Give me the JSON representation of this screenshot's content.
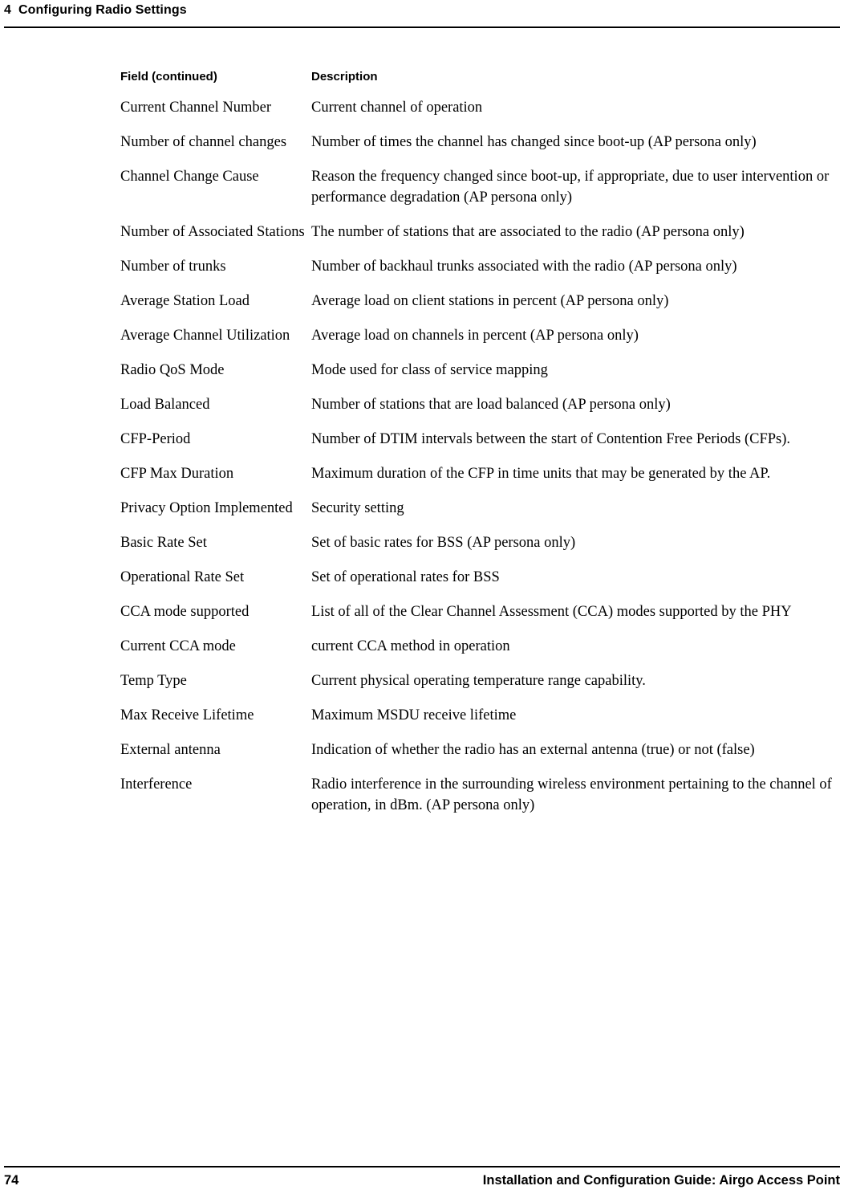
{
  "header": {
    "chapter_number": "4",
    "chapter_title": "Configuring Radio Settings"
  },
  "table": {
    "columns": {
      "field": "Field  (continued)",
      "description": "Description"
    },
    "rows": [
      {
        "field": "Current Channel Number",
        "description": "Current channel of operation"
      },
      {
        "field": "Number of channel changes",
        "description": "Number of times the channel has changed since boot-up (AP persona only)"
      },
      {
        "field": "Channel Change Cause",
        "description": "Reason the frequency changed since boot-up, if appropriate, due to user intervention or performance degradation (AP persona only)"
      },
      {
        "field": "Number of Associated Stations",
        "description": "The number of stations that are associated to the radio (AP persona only)"
      },
      {
        "field": "Number of trunks",
        "description": "Number of backhaul trunks associated with the radio (AP persona only)"
      },
      {
        "field": "Average Station Load",
        "description": "Average load on client stations in percent (AP persona only)"
      },
      {
        "field": "Average Channel Utilization",
        "description": "Average load on channels in percent (AP persona only)"
      },
      {
        "field": "Radio QoS Mode",
        "description": "Mode used for class of service mapping"
      },
      {
        "field": "Load Balanced",
        "description": "Number of stations that are load balanced (AP persona only)"
      },
      {
        "field": "CFP-Period",
        "description": "Number of DTIM intervals between the start of Contention Free Periods (CFPs)."
      },
      {
        "field": "CFP Max Duration",
        "description": "Maximum duration of the CFP in time units that may be generated by the AP."
      },
      {
        "field": "Privacy Option Implemented",
        "description": "Security setting"
      },
      {
        "field": "Basic Rate Set",
        "description": "Set of basic rates for BSS (AP persona only)"
      },
      {
        "field": "Operational Rate Set",
        "description": "Set of operational rates for BSS"
      },
      {
        "field": "CCA mode supported",
        "description": "List of all of the Clear Channel Assessment (CCA) modes supported by the PHY"
      },
      {
        "field": "Current CCA mode",
        "description": "current CCA method in operation"
      },
      {
        "field": "Temp Type",
        "description": "Current physical operating temperature range capability."
      },
      {
        "field": "Max Receive Lifetime",
        "description": "Maximum MSDU receive lifetime"
      },
      {
        "field": "External antenna",
        "description": "Indication of whether the radio has an external antenna (true) or not (false)"
      },
      {
        "field": "Interference",
        "description": "Radio interference in the surrounding wireless environment pertaining to the channel of operation, in dBm. (AP persona only)"
      }
    ]
  },
  "footer": {
    "page_number": "74",
    "guide_title": "Installation and Configuration Guide: Airgo Access Point"
  }
}
